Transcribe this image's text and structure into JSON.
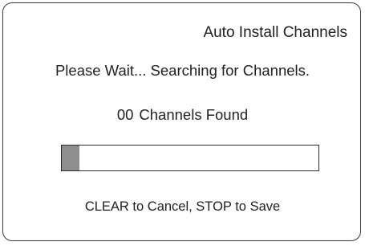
{
  "dialog": {
    "title": "Auto Install Channels",
    "message": "Please Wait... Searching for Channels.",
    "channels_found": {
      "count": "00",
      "label": "Channels Found"
    },
    "progress": {
      "fraction": 0.07,
      "fill_color": "#8e8e8e"
    },
    "hint": "CLEAR to Cancel, STOP to Save"
  }
}
